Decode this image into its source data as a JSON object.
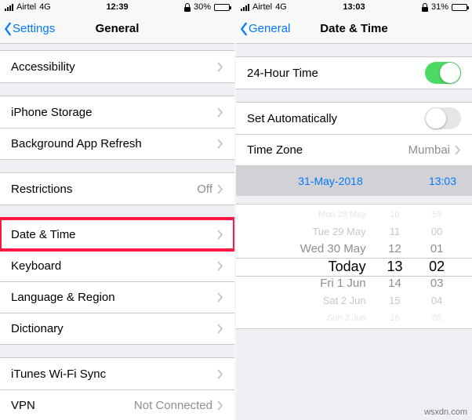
{
  "left": {
    "status": {
      "carrier": "Airtel",
      "network": "4G",
      "time": "12:39",
      "battery": "30%"
    },
    "nav": {
      "back": "Settings",
      "title": "General"
    },
    "rows": {
      "accessibility": "Accessibility",
      "iphone_storage": "iPhone Storage",
      "background_refresh": "Background App Refresh",
      "restrictions": "Restrictions",
      "restrictions_value": "Off",
      "date_time": "Date & Time",
      "keyboard": "Keyboard",
      "language_region": "Language & Region",
      "dictionary": "Dictionary",
      "itunes_wifi": "iTunes Wi-Fi Sync",
      "vpn": "VPN",
      "vpn_value": "Not Connected"
    }
  },
  "right": {
    "status": {
      "carrier": "Airtel",
      "network": "4G",
      "time": "13:03",
      "battery": "31%"
    },
    "nav": {
      "back": "General",
      "title": "Date & Time"
    },
    "rows": {
      "hour24": "24-Hour Time",
      "set_auto": "Set Automatically",
      "timezone": "Time Zone",
      "timezone_value": "Mumbai"
    },
    "selected": {
      "date": "31-May-2018",
      "time": "13:03"
    },
    "picker": {
      "dates": [
        "Mon 28 May",
        "Tue 29 May",
        "Wed 30 May",
        "Today",
        "Fri 1 Jun",
        "Sat 2 Jun",
        "Sun 3 Jun"
      ],
      "hours": [
        "10",
        "11",
        "12",
        "13",
        "14",
        "15",
        "16"
      ],
      "mins": [
        "59",
        "00",
        "01",
        "02",
        "03",
        "04",
        "05"
      ]
    }
  },
  "watermark": "wsxdn.com"
}
